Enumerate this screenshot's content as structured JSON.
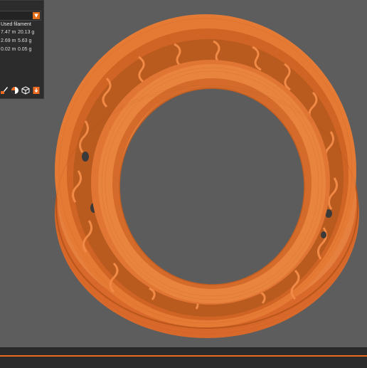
{
  "legend": {
    "column_header": "Used filament",
    "rows": [
      {
        "length": "7.47 m",
        "weight": "20.13 g"
      },
      {
        "length": "2.69 m",
        "weight": "5.63 g"
      },
      {
        "length": "0.02 m",
        "weight": "0.05 g"
      }
    ],
    "toolbar_icons": [
      "brush-icon",
      "contrast-icon",
      "cube-icon",
      "export-icon"
    ]
  },
  "colors": {
    "accent": "#ed6b21",
    "model": "#e07834",
    "background": "#5d5d5e",
    "panel": "#2c2c2c"
  }
}
